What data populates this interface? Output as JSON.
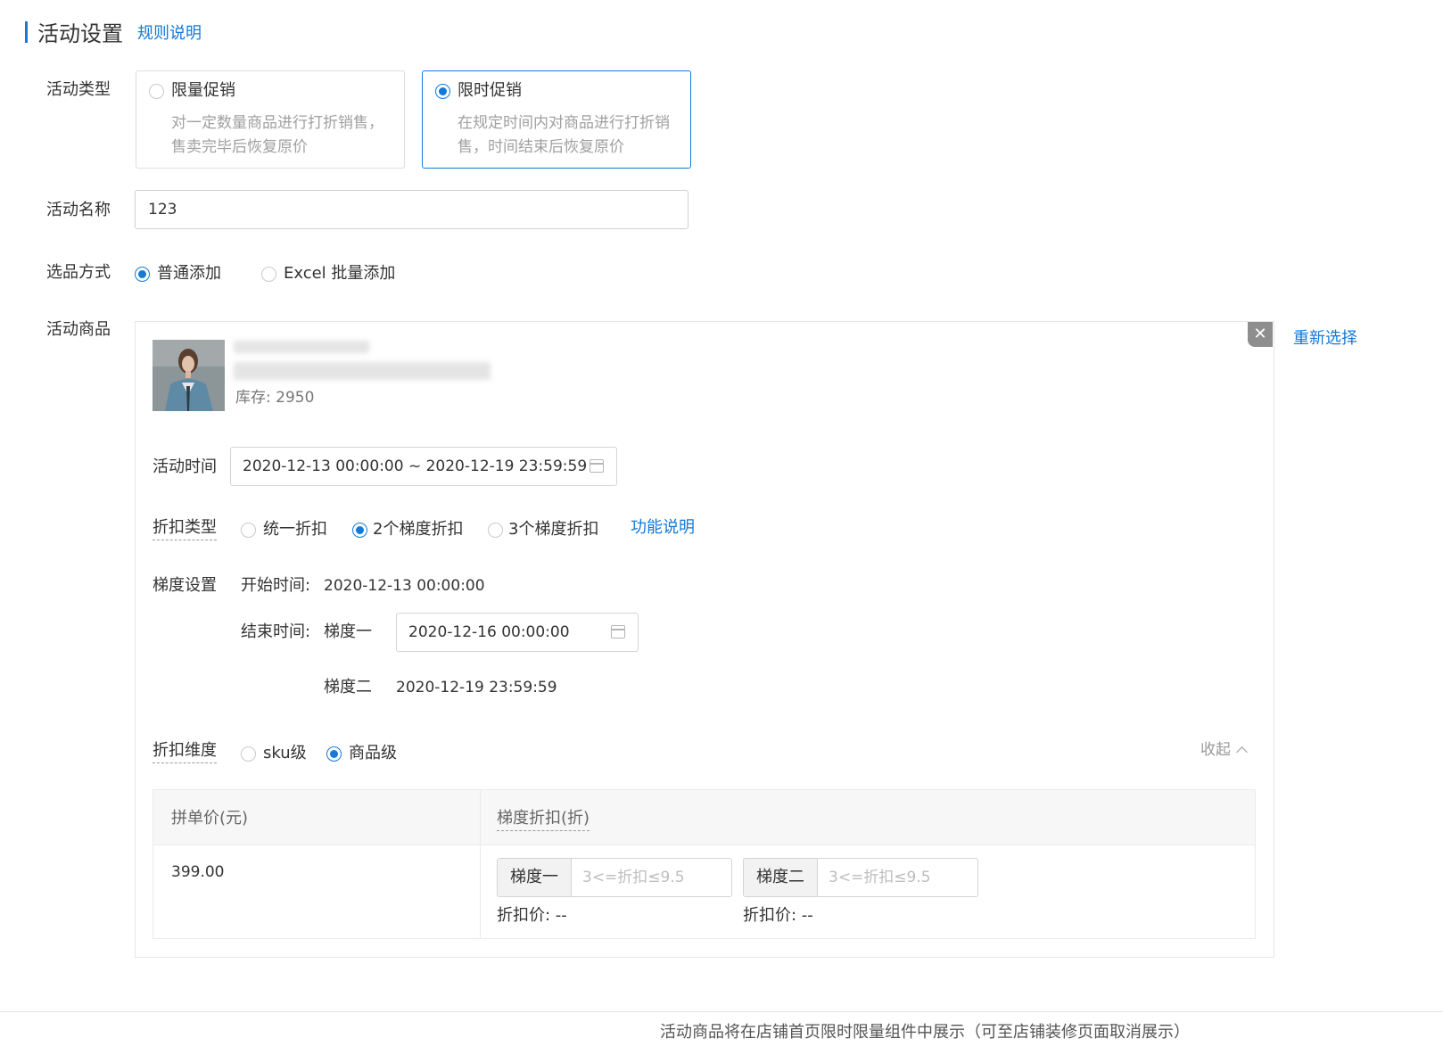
{
  "header": {
    "title": "活动设置",
    "rules_link": "规则说明"
  },
  "activity_type": {
    "label": "活动类型",
    "options": [
      {
        "title": "限量促销",
        "desc": "对一定数量商品进行打折销售，售卖完毕后恢复原价",
        "selected": false
      },
      {
        "title": "限时促销",
        "desc": "在规定时间内对商品进行打折销售，时间结束后恢复原价",
        "selected": true
      }
    ]
  },
  "activity_name": {
    "label": "活动名称",
    "value": "123"
  },
  "selection_method": {
    "label": "选品方式",
    "options": [
      {
        "label": "普通添加",
        "selected": true
      },
      {
        "label": "Excel 批量添加",
        "selected": false
      }
    ]
  },
  "activity_goods": {
    "label": "活动商品",
    "reselect": "重新选择",
    "close_icon": "close-icon",
    "stock": "库存: 2950",
    "time": {
      "label": "活动时间",
      "value": "2020-12-13 00:00:00 ~ 2020-12-19 23:59:59"
    },
    "discount_type": {
      "label": "折扣类型",
      "options": [
        {
          "label": "统一折扣",
          "selected": false
        },
        {
          "label": "2个梯度折扣",
          "selected": true
        },
        {
          "label": "3个梯度折扣",
          "selected": false
        }
      ],
      "help_link": "功能说明"
    },
    "tier_settings": {
      "label": "梯度设置",
      "start_label": "开始时间:",
      "start_value": "2020-12-13 00:00:00",
      "end_label": "结束时间:",
      "tier1_label": "梯度一",
      "tier1_value": "2020-12-16 00:00:00",
      "tier2_label": "梯度二",
      "tier2_value": "2020-12-19 23:59:59"
    },
    "discount_dimension": {
      "label": "折扣维度",
      "options": [
        {
          "label": "sku级",
          "selected": false
        },
        {
          "label": "商品级",
          "selected": true
        }
      ],
      "collapse": "收起"
    },
    "table": {
      "headers": [
        "拼单价(元)",
        "梯度折扣(折)"
      ],
      "row": {
        "price": "399.00",
        "tiers": [
          {
            "addon": "梯度一",
            "placeholder": "3<=折扣≤9.5",
            "result": "折扣价: --"
          },
          {
            "addon": "梯度二",
            "placeholder": "3<=折扣≤9.5",
            "result": "折扣价: --"
          }
        ]
      }
    }
  },
  "footer": {
    "note": "活动商品将在店铺首页限时限量组件中展示（可至店铺装修页面取消展示）"
  },
  "colors": {
    "accent": "#1479d7",
    "muted": "#a0a0a0"
  }
}
